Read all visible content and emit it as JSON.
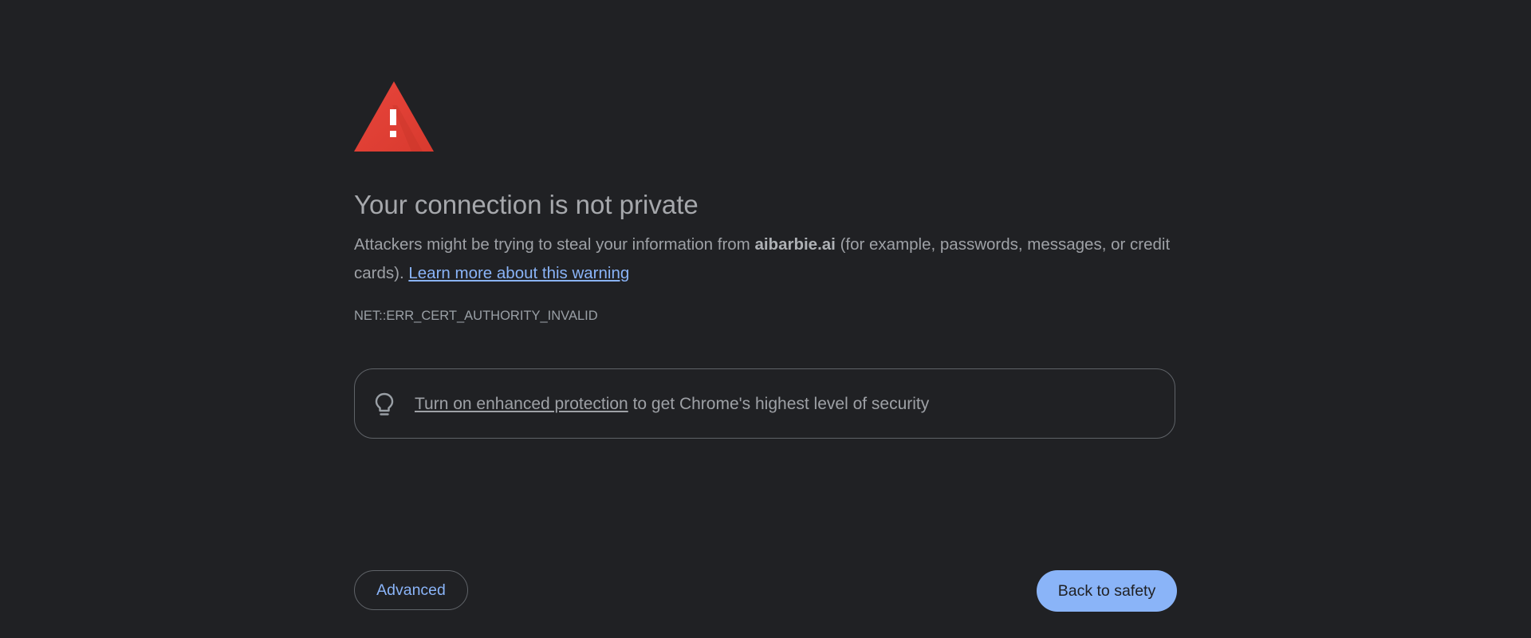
{
  "page": {
    "title": "Your connection is not private",
    "description": {
      "before_host": "Attackers might be trying to steal your information from ",
      "host": "aibarbie.ai",
      "after_host": " (for example, passwords, messages, or credit cards). ",
      "link_text": "Learn more about this warning"
    },
    "error_code": "NET::ERR_CERT_AUTHORITY_INVALID"
  },
  "promo": {
    "icon": "lightbulb-icon",
    "link_text": "Turn on enhanced protection",
    "rest_text": " to get Chrome's highest level of security"
  },
  "buttons": {
    "advanced_label": "Advanced",
    "back_label": "Back to safety"
  },
  "colors": {
    "background": "#202124",
    "warning_red": "#e34133",
    "link_blue": "#8ab4f8",
    "primary_button": "#8ab4f8",
    "border": "#5f6368"
  }
}
